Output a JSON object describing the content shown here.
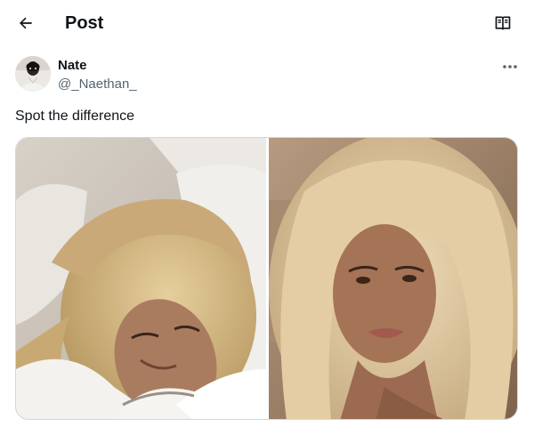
{
  "header": {
    "title": "Post",
    "back_icon": "arrow-left-icon",
    "reader_icon": "reader-mode-icon"
  },
  "author": {
    "name": "Nate",
    "handle": "@_Naethan_",
    "more_icon": "more-icon"
  },
  "post": {
    "text": "Spot the difference"
  },
  "media": {
    "count": 2
  }
}
